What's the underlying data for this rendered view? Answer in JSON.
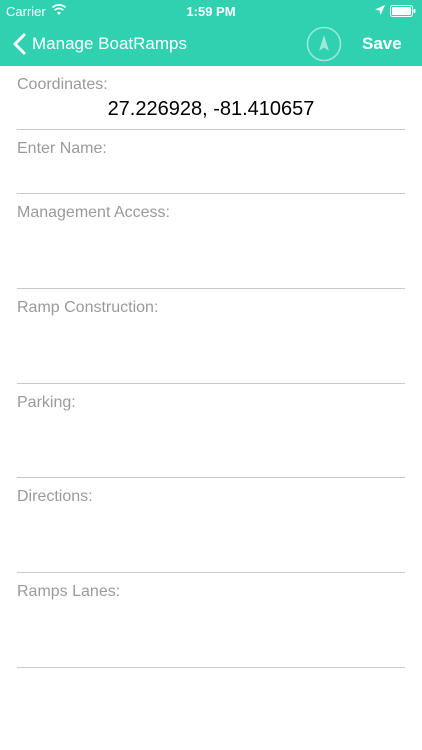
{
  "status_bar": {
    "carrier": "Carrier",
    "time": "1:59 PM",
    "icons": [
      "wifi-icon",
      "location-arrow-icon",
      "battery-icon"
    ]
  },
  "nav": {
    "back_label": "Manage BoatRamps",
    "compass_icon": "compass-icon",
    "save_label": "Save"
  },
  "colors": {
    "accent": "#2fd1b1",
    "label": "#9a9a9a",
    "divider": "#c8c8c8"
  },
  "form": {
    "coordinates_label": "Coordinates:",
    "coordinates_value": "27.226928, -81.410657",
    "name_label": "Enter Name:",
    "management_access_label": "Management Access:",
    "ramp_construction_label": "Ramp Construction:",
    "parking_label": "Parking:",
    "directions_label": "Directions:",
    "ramps_lanes_label": "Ramps Lanes:"
  }
}
